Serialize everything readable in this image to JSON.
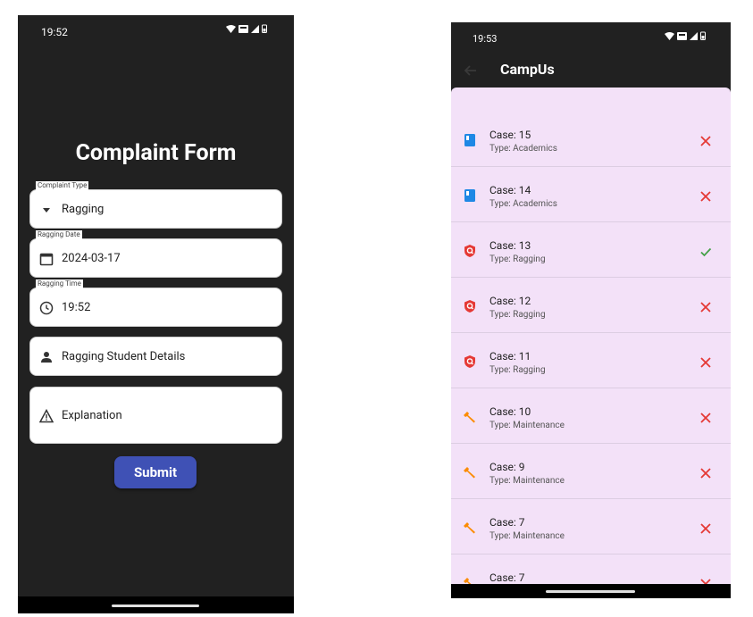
{
  "form_screen": {
    "status_time": "19:52",
    "title": "Complaint Form",
    "fields": [
      {
        "label": "Complaint Type",
        "value": "Ragging",
        "icon": "dropdown-arrow-icon"
      },
      {
        "label": "Ragging Date",
        "value": "2024-03-17",
        "icon": "calendar-icon"
      },
      {
        "label": "Ragging Time",
        "value": "19:52",
        "icon": "clock-icon"
      },
      {
        "label": "",
        "value": "Ragging Student Details",
        "icon": "person-icon"
      },
      {
        "label": "",
        "value": "Explanation",
        "icon": "warning-icon"
      }
    ],
    "submit_label": "Submit"
  },
  "list_screen": {
    "status_time": "19:53",
    "app_title": "CampUs",
    "cases": [
      {
        "case": "Case: 15",
        "type": "Type: Academics",
        "icon": "book-icon",
        "status": "rejected"
      },
      {
        "case": "Case: 14",
        "type": "Type: Academics",
        "icon": "book-icon",
        "status": "rejected"
      },
      {
        "case": "Case: 13",
        "type": "Type: Ragging",
        "icon": "shield-icon",
        "status": "resolved"
      },
      {
        "case": "Case: 12",
        "type": "Type: Ragging",
        "icon": "shield-icon",
        "status": "rejected"
      },
      {
        "case": "Case: 11",
        "type": "Type: Ragging",
        "icon": "shield-icon",
        "status": "rejected"
      },
      {
        "case": "Case: 10",
        "type": "Type: Maintenance",
        "icon": "wrench-icon",
        "status": "rejected"
      },
      {
        "case": "Case: 9",
        "type": "Type: Maintenance",
        "icon": "wrench-icon",
        "status": "rejected"
      },
      {
        "case": "Case: 7",
        "type": "Type: Maintenance",
        "icon": "wrench-icon",
        "status": "rejected"
      },
      {
        "case": "Case: 7",
        "type": "",
        "icon": "wrench-icon",
        "status": "rejected"
      }
    ]
  },
  "colors": {
    "dark_background": "#212121",
    "submit_button": "#3f51b5",
    "list_background": "#f3e1f8",
    "reject_red": "#e53935",
    "resolved_green": "#43a047",
    "book_blue": "#1e88e5",
    "shield_red": "#e53935",
    "wrench_orange": "#fb8c00"
  }
}
